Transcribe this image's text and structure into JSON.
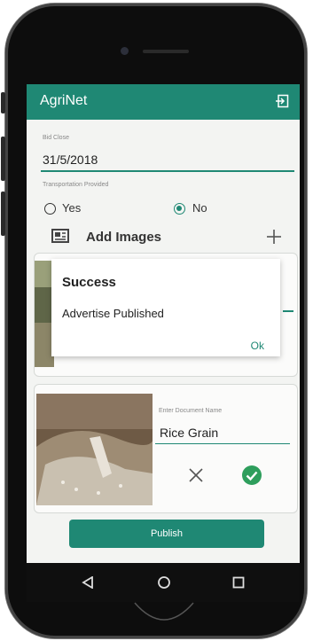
{
  "app": {
    "title": "AgriNet"
  },
  "form": {
    "bid_close_label": "Bid Close",
    "bid_close_value": "31/5/2018",
    "transport_label": "Transportation Provided",
    "yes_label": "Yes",
    "no_label": "No",
    "selected_option": "No",
    "add_images_label": "Add Images"
  },
  "dialog": {
    "title": "Success",
    "message": "Advertise Published",
    "ok_label": "Ok"
  },
  "document": {
    "name_placeholder": "Enter Document Name",
    "name_value": "Rice Grain"
  },
  "publish_label": "Publish",
  "colors": {
    "accent": "#1f8874",
    "check": "#2e9e5c"
  },
  "icons": [
    "logout-icon",
    "image-icon",
    "plus-icon",
    "close-icon",
    "check-circle-icon",
    "back-icon",
    "home-icon",
    "recents-icon"
  ]
}
